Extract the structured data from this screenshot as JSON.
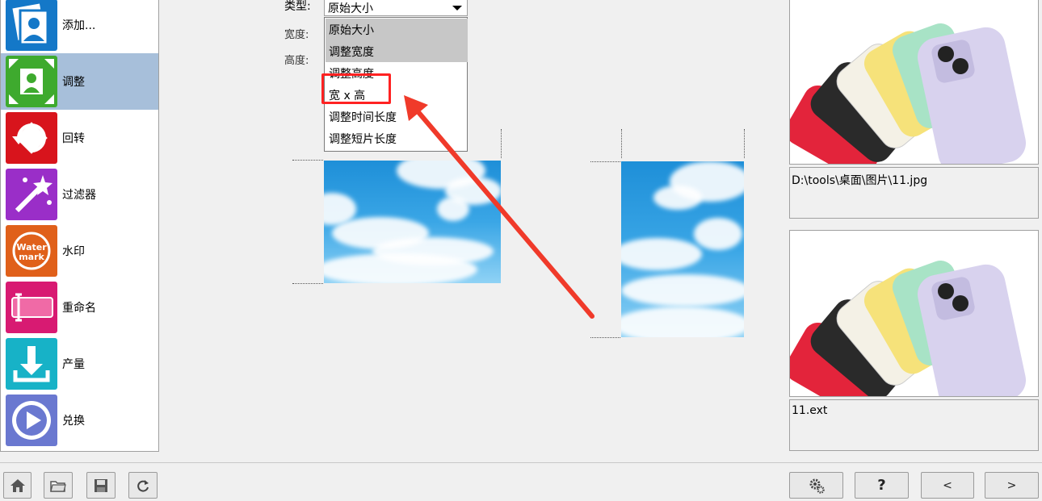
{
  "sidebar": {
    "items": [
      {
        "label": "添加...",
        "icon": "add-photos-icon",
        "color": "#1478c8"
      },
      {
        "label": "调整",
        "icon": "resize-icon",
        "color": "#3eaa2e"
      },
      {
        "label": "回转",
        "icon": "rotate-icon",
        "color": "#d8141c"
      },
      {
        "label": "过滤器",
        "icon": "magic-wand-icon",
        "color": "#9a2ec8"
      },
      {
        "label": "水印",
        "icon": "watermark-icon",
        "color": "#e0601a"
      },
      {
        "label": "重命名",
        "icon": "rename-icon",
        "color": "#d81a72"
      },
      {
        "label": "产量",
        "icon": "download-output-icon",
        "color": "#17b2c7"
      },
      {
        "label": "兑换",
        "icon": "convert-play-icon",
        "color": "#6a78d0"
      }
    ],
    "watermark_logo_text": "Water mark"
  },
  "options": {
    "type_label": "类型:",
    "width_label": "宽度:",
    "height_label": "高度:",
    "type_value": "原始大小",
    "dropdown_options": [
      "原始大小",
      "调整宽度",
      "调整高度",
      "宽 x 高",
      "调整时间长度",
      "调整短片长度"
    ]
  },
  "right_panel": {
    "source_path": "D:\\tools\\桌面\\图片\\11.jpg",
    "output_name": "11.ext"
  },
  "toolbar": {
    "help_label": "?",
    "prev_label": "<",
    "next_label": ">"
  },
  "colors": {
    "active_item": "#a7bfda",
    "highlight_box": "#ff2222",
    "arrow": "#f03a2a"
  }
}
